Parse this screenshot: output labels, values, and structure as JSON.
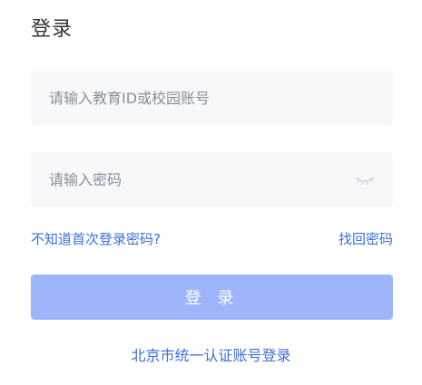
{
  "page": {
    "title": "登录"
  },
  "account": {
    "placeholder": "请输入教育ID或校园账号",
    "value": ""
  },
  "password": {
    "placeholder": "请输入密码",
    "value": "",
    "toggle_icon": "eye-closed-icon"
  },
  "links": {
    "first_login": "不知道首次登录密码?",
    "recover": "找回密码"
  },
  "login_button": {
    "label": "登 录"
  },
  "sso": {
    "label": "北京市统一认证账号登录"
  },
  "colors": {
    "accent": "#3c6edc",
    "button_bg": "#9eb4fb",
    "field_bg": "#f7f8fa"
  }
}
